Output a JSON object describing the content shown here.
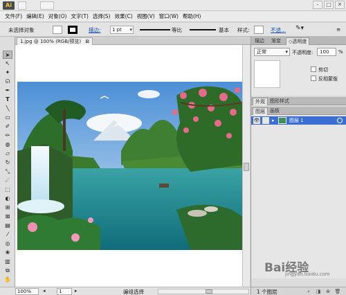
{
  "app": {
    "logo_text": "Ai"
  },
  "menu": [
    "文件(F)",
    "编辑(E)",
    "对象(O)",
    "文字(T)",
    "选择(S)",
    "效果(C)",
    "视图(V)",
    "窗口(W)",
    "帮助(H)"
  ],
  "control_bar": {
    "selection_status": "未选择对象",
    "stroke_label": "描边:",
    "stroke_weight": "1 pt",
    "profile_label": "等比",
    "brush_label": "基本",
    "style_label": "样式:",
    "opacity_link": "不透..."
  },
  "document_tab": {
    "title": "1.jpg @ 100% (RGB/预览)",
    "close_glyph": "⊠"
  },
  "panels": {
    "top_tabs": [
      "描边",
      "渐变",
      "◇透明度"
    ],
    "transparency": {
      "blend_mode": "正常",
      "opacity_label": "不透明度:",
      "opacity_value": "100",
      "opacity_unit": "%",
      "clip_label": "剪切",
      "invert_mask_label": "反相蒙版"
    },
    "appearance_tabs": [
      "外观",
      "图形样式"
    ],
    "layers_tabs": [
      "图层",
      "画板"
    ],
    "layer": {
      "name": "图层 1"
    },
    "footer": {
      "count": "1 个图层"
    }
  },
  "status_bar": {
    "zoom": "100%",
    "artboard": "1",
    "tool_status": "编组选择"
  },
  "watermark": {
    "main": "Bai经验",
    "sub": "jingyan.baidu.com"
  },
  "colors": {
    "layer_highlight": "#3a6ed2",
    "fill": "#ffffff",
    "stroke": "#000000"
  },
  "tools": [
    "selection-tool",
    "direct-selection-tool",
    "magic-wand-tool",
    "lasso-tool",
    "pen-tool",
    "type-tool",
    "line-tool",
    "rectangle-tool",
    "paintbrush-tool",
    "pencil-tool",
    "blob-brush-tool",
    "eraser-tool",
    "rotate-tool",
    "scale-tool",
    "warp-tool",
    "free-transform-tool",
    "shape-builder-tool",
    "perspective-grid-tool",
    "mesh-tool",
    "gradient-tool",
    "eyedropper-tool",
    "blend-tool",
    "symbol-sprayer-tool",
    "column-graph-tool",
    "artboard-tool",
    "slice-tool",
    "hand-tool",
    "zoom-tool",
    "fill-stroke-swatch"
  ]
}
